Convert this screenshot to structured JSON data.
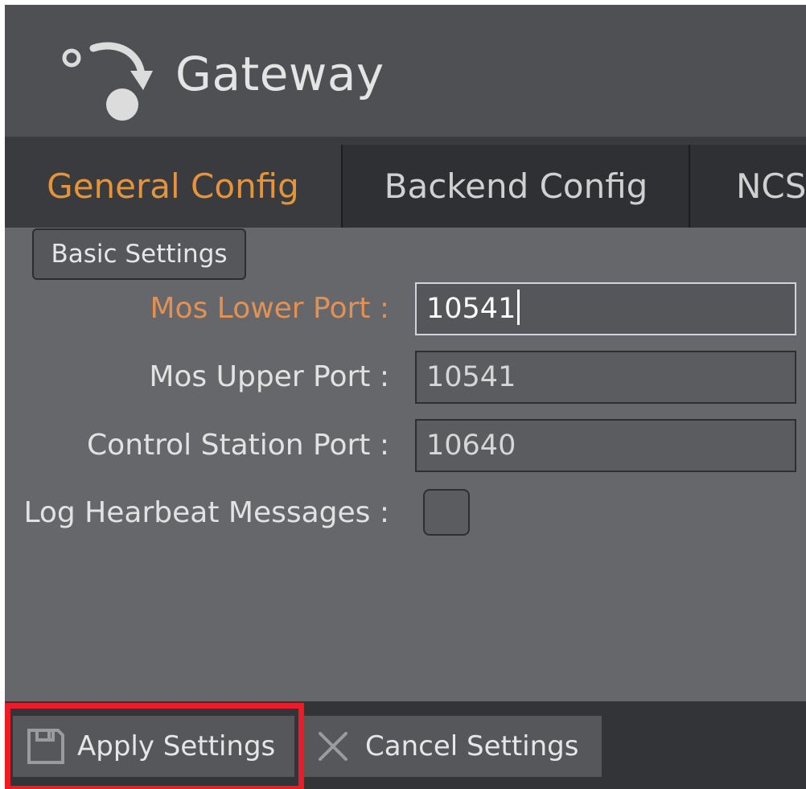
{
  "app": {
    "title": "Gateway"
  },
  "tabs": [
    {
      "label": "General Config",
      "active": true
    },
    {
      "label": "Backend Config",
      "active": false
    },
    {
      "label": "NCS",
      "active": false
    }
  ],
  "section": {
    "label": "Basic Settings"
  },
  "form": {
    "mos_lower_port": {
      "label": "Mos Lower Port :",
      "value": "10541",
      "focused": true
    },
    "mos_upper_port": {
      "label": "Mos Upper Port :",
      "value": "10541"
    },
    "control_station_port": {
      "label": "Control Station Port :",
      "value": "10640"
    },
    "log_heartbeat": {
      "label": "Log Hearbeat Messages :",
      "checked": false
    }
  },
  "footer": {
    "apply_label": "Apply Settings",
    "cancel_label": "Cancel Settings",
    "apply_icon": "save-icon",
    "cancel_icon": "close-icon"
  },
  "colors": {
    "accent": "#e4943a",
    "focus_label": "#e29154",
    "highlight": "#ed1c24",
    "background": "#66676a"
  }
}
